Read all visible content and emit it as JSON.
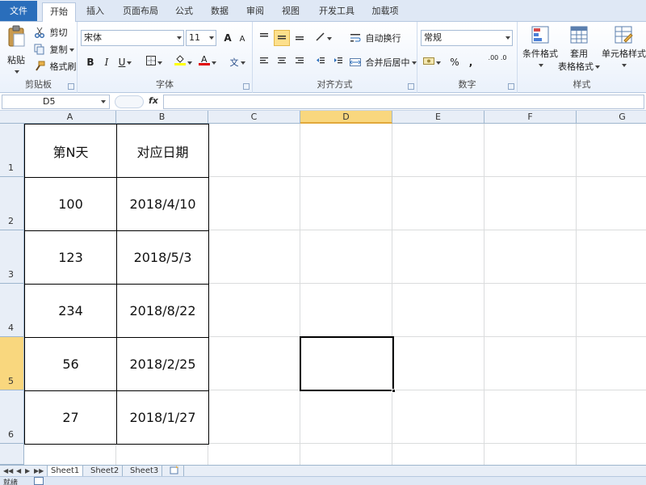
{
  "tabs": {
    "file": "文件",
    "items": [
      "开始",
      "插入",
      "页面布局",
      "公式",
      "数据",
      "审阅",
      "视图",
      "开发工具",
      "加载项"
    ]
  },
  "ribbon": {
    "clipboard": {
      "paste": "粘贴",
      "cut": "剪切",
      "copy": "复制",
      "format_painter": "格式刷",
      "label": "剪贴板"
    },
    "font": {
      "name": "宋体",
      "size": "11",
      "bold": "B",
      "italic": "I",
      "underline": "U",
      "grow": "A",
      "shrink": "A",
      "wen": "文",
      "label": "字体"
    },
    "alignment": {
      "wrap_text": "自动换行",
      "merge_center": "合并后居中",
      "label": "对齐方式"
    },
    "number": {
      "format": "常规",
      "percent": "%",
      "comma": ",",
      "inc_dec": ".00 .0",
      "label": "数字"
    },
    "styles": {
      "conditional": "条件格式",
      "table_line1": "套用",
      "table_line2": "表格格式",
      "cell_styles": "单元格样式",
      "label": "样式"
    }
  },
  "formula_bar": {
    "name_box": "D5",
    "fx": "fx",
    "value": ""
  },
  "columns": [
    "A",
    "B",
    "C",
    "D",
    "E",
    "F",
    "G"
  ],
  "active_column": "D",
  "rows": [
    "1",
    "2",
    "3",
    "4",
    "5",
    "6"
  ],
  "active_row": "5",
  "table": [
    [
      "第N天",
      "对应日期"
    ],
    [
      "100",
      "2018/4/10"
    ],
    [
      "123",
      "2018/5/3"
    ],
    [
      "234",
      "2018/8/22"
    ],
    [
      "56",
      "2018/2/25"
    ],
    [
      "27",
      "2018/1/27"
    ]
  ],
  "sheet_tabs": [
    "Sheet1",
    "Sheet2",
    "Sheet3"
  ],
  "active_sheet": "Sheet1",
  "status": {
    "ready": "就绪"
  },
  "colors": {
    "file_tab": "#2a6ebb",
    "active_header": "#f9d77e",
    "ribbon_bg": "#dfe8f5"
  }
}
